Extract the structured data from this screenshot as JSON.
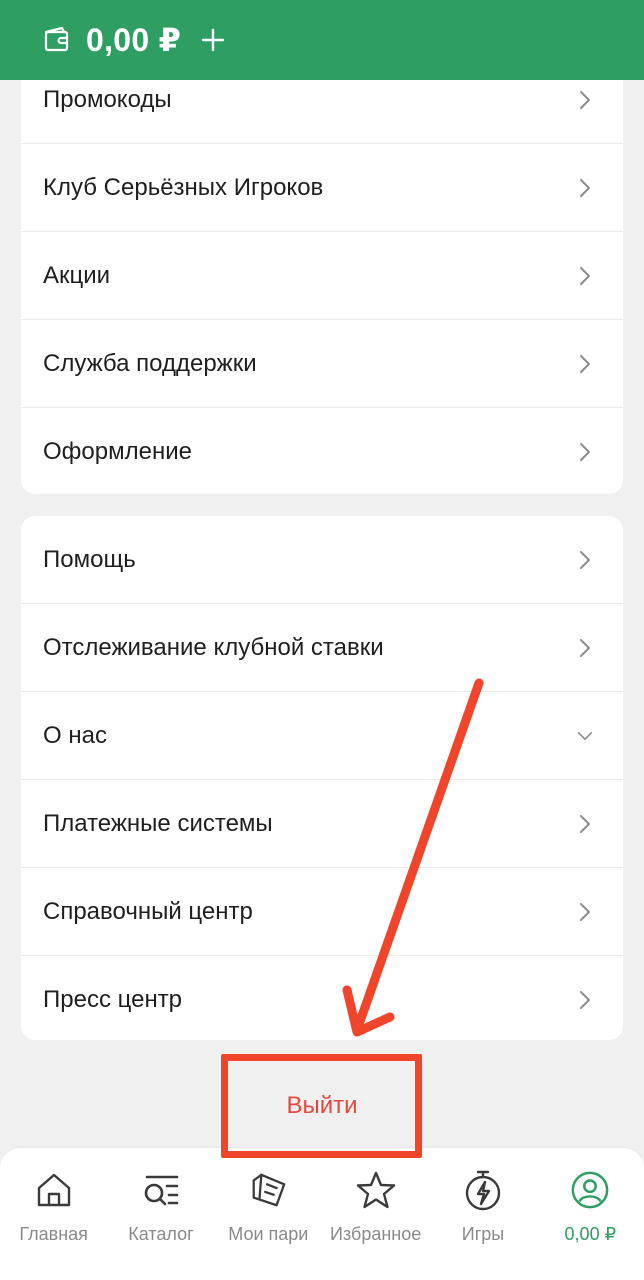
{
  "header": {
    "balance": "0,00 ₽",
    "wallet_icon": "wallet-icon",
    "add_icon": "plus-icon"
  },
  "menu_group_1": [
    {
      "label": "Промокоды",
      "chevron": "chevron-right-icon"
    },
    {
      "label": "Клуб Серьёзных Игроков",
      "chevron": "chevron-right-icon"
    },
    {
      "label": "Акции",
      "chevron": "chevron-right-icon"
    },
    {
      "label": "Служба поддержки",
      "chevron": "chevron-right-icon"
    },
    {
      "label": "Оформление",
      "chevron": "chevron-right-icon"
    }
  ],
  "menu_group_2": [
    {
      "label": "Помощь",
      "chevron": "chevron-right-icon"
    },
    {
      "label": "Отслеживание клубной ставки",
      "chevron": "chevron-right-icon"
    },
    {
      "label": "О нас",
      "chevron": "chevron-down-icon"
    },
    {
      "label": "Платежные системы",
      "chevron": "chevron-right-icon"
    },
    {
      "label": "Справочный центр",
      "chevron": "chevron-right-icon"
    },
    {
      "label": "Пресс центр",
      "chevron": "chevron-right-icon"
    }
  ],
  "logout": {
    "label": "Выйти"
  },
  "tabbar": {
    "home": "Главная",
    "catalog": "Каталог",
    "my_bets": "Мои пари",
    "favorites": "Избранное",
    "games": "Игры",
    "profile": "0,00 ₽"
  },
  "colors": {
    "brand_green": "#2f9e62",
    "logout_red": "#e5483f",
    "annotation_red": "#f0452a"
  }
}
